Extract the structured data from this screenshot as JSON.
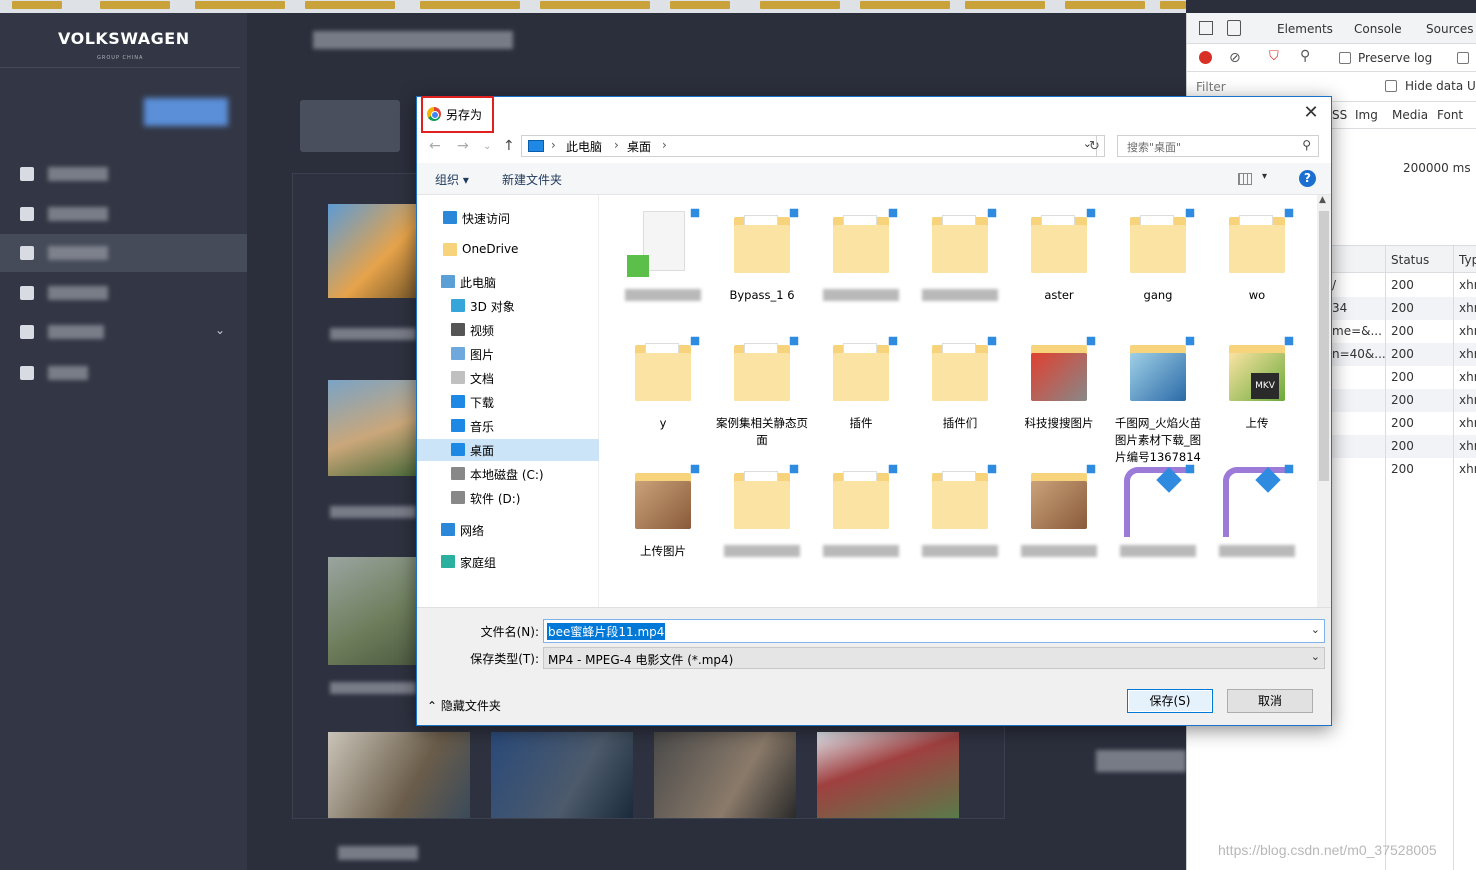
{
  "app": {
    "brand": "VOLKSWAGEN",
    "brand_sub": "GROUP CHINA"
  },
  "devtools": {
    "tabs": [
      "Elements",
      "Console",
      "Sources"
    ],
    "preserve_log": "Preserve log",
    "filter_placeholder": "Filter",
    "hide_data": "Hide data UI",
    "type_tabs": [
      "SS",
      "Img",
      "Media",
      "Font"
    ],
    "timing": "200000 ms",
    "columns": [
      "Status",
      "Typ"
    ],
    "rows": [
      {
        "name": "/",
        "status": "200",
        "type": "xhr"
      },
      {
        "name": "34",
        "status": "200",
        "type": "xhr"
      },
      {
        "name": "me=&...",
        "status": "200",
        "type": "xhr"
      },
      {
        "name": "n=40&...",
        "status": "200",
        "type": "xhr"
      },
      {
        "name": "",
        "status": "200",
        "type": "xhr"
      },
      {
        "name": "",
        "status": "200",
        "type": "xhr"
      },
      {
        "name": "",
        "status": "200",
        "type": "xhr"
      },
      {
        "name": "",
        "status": "200",
        "type": "xhr"
      },
      {
        "name": "",
        "status": "200",
        "type": "xhr"
      }
    ]
  },
  "dialog": {
    "title": "另存为",
    "close": "✕",
    "breadcrumb": [
      "此电脑",
      "桌面"
    ],
    "search_placeholder": "搜索\"桌面\"",
    "toolbar": {
      "organize": "组织 ▾",
      "new_folder": "新建文件夹",
      "help": "?"
    },
    "nav": [
      {
        "label": "快速访问",
        "icon": "star-icon",
        "color": "#2b88d8"
      },
      {
        "label": "OneDrive",
        "icon": "folder-icon",
        "color": "#f7d37c"
      },
      {
        "label": "此电脑",
        "icon": "computer-icon",
        "color": "#5a9fd6"
      },
      {
        "label": "3D 对象",
        "icon": "cube-icon",
        "color": "#36a5d9"
      },
      {
        "label": "视频",
        "icon": "video-icon",
        "color": "#555"
      },
      {
        "label": "图片",
        "icon": "picture-icon",
        "color": "#6fa8dc"
      },
      {
        "label": "文档",
        "icon": "document-icon",
        "color": "#c0c0c0"
      },
      {
        "label": "下载",
        "icon": "download-icon",
        "color": "#1e88e5"
      },
      {
        "label": "音乐",
        "icon": "music-icon",
        "color": "#1e88e5"
      },
      {
        "label": "桌面",
        "icon": "desktop-icon",
        "color": "#1e88e5"
      },
      {
        "label": "本地磁盘 (C:)",
        "icon": "drive-icon",
        "color": "#888"
      },
      {
        "label": "软件 (D:)",
        "icon": "drive-icon",
        "color": "#888"
      },
      {
        "label": "网络",
        "icon": "network-icon",
        "color": "#2b88d8"
      },
      {
        "label": "家庭组",
        "icon": "homegroup-icon",
        "color": "#2bb0a0"
      }
    ],
    "files": [
      {
        "name": "",
        "kind": "doc"
      },
      {
        "name": "Bypass_1 6",
        "kind": "folder"
      },
      {
        "name": "",
        "kind": "folder"
      },
      {
        "name": "",
        "kind": "folder"
      },
      {
        "name": "aster",
        "kind": "folder"
      },
      {
        "name": "gang",
        "kind": "folder"
      },
      {
        "name": "wo",
        "kind": "folder"
      },
      {
        "name": "y",
        "kind": "folder"
      },
      {
        "name": "案例集相关静态页面",
        "kind": "folder"
      },
      {
        "name": "插件",
        "kind": "folder"
      },
      {
        "name": "插件们",
        "kind": "folder"
      },
      {
        "name": "科技搜搜图片",
        "kind": "image"
      },
      {
        "name": "千图网_火焰火苗图片素材下载_图片编号1367814",
        "kind": "image"
      },
      {
        "name": "上传",
        "kind": "mkv"
      },
      {
        "name": "上传图片",
        "kind": "image"
      },
      {
        "name": "",
        "kind": "folder"
      },
      {
        "name": "",
        "kind": "folder"
      },
      {
        "name": "",
        "kind": "folder"
      },
      {
        "name": "",
        "kind": "image"
      },
      {
        "name": "",
        "kind": "app"
      },
      {
        "name": "",
        "kind": "app"
      }
    ],
    "filename_label": "文件名(N):",
    "filename": "bee蜜蜂片段11.mp4",
    "filetype_label": "保存类型(T):",
    "filetype": "MP4 - MPEG-4 电影文件 (*.mp4)",
    "hide_folders": "隐藏文件夹",
    "save": "保存(S)",
    "cancel": "取消"
  },
  "watermark": "https://blog.csdn.net/m0_37528005"
}
